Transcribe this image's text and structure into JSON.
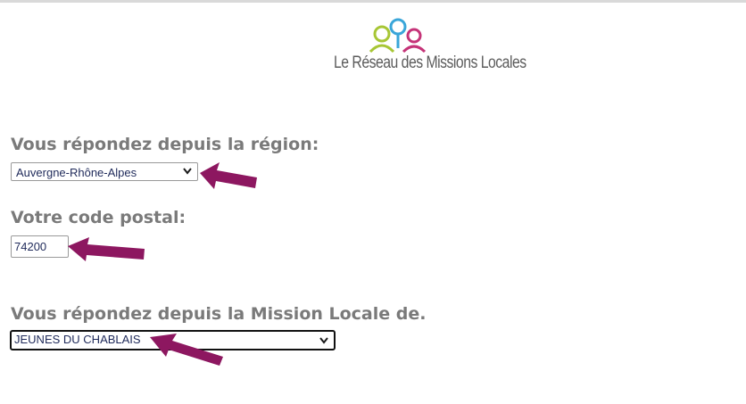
{
  "logo": {
    "text": "Le Réseau des Missions Locales",
    "colors": {
      "green": "#a7c635",
      "blue": "#3aa6d9",
      "magenta": "#c53378"
    }
  },
  "form": {
    "region": {
      "label": "Vous répondez depuis la région:",
      "selected": "Auvergne-Rhône-Alpes"
    },
    "postal_code": {
      "label": "Votre code postal:",
      "value": "74200"
    },
    "mission_locale": {
      "label": "Vous répondez depuis la Mission Locale de.",
      "selected": "JEUNES DU CHABLAIS"
    }
  },
  "annotations": {
    "arrow_color": "#8d1760",
    "arrow_icon": "left-pointing-arrow"
  }
}
